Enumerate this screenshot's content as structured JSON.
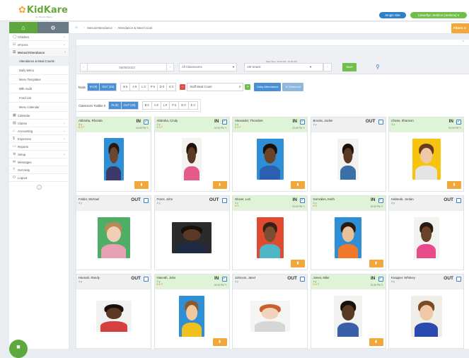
{
  "app": {
    "logo": "KidKare",
    "logo_tag": "by Minute Menu"
  },
  "header": {
    "site_button": "Single Site",
    "user_button": "Llewellyn Jenkins (Jenkins) ▾"
  },
  "sidebar": {
    "items": [
      {
        "label": "Children",
        "icon": "child-icon",
        "chevron": true
      },
      {
        "label": "eForms",
        "icon": "form-icon",
        "chevron": true
      },
      {
        "label": "Menus/Attendance",
        "icon": "menu-icon",
        "chevron": true,
        "active": true
      },
      {
        "label": "Calendar",
        "icon": "calendar-icon"
      },
      {
        "label": "Claims",
        "icon": "claims-icon",
        "chevron": true
      },
      {
        "label": "Accounting",
        "icon": "accounting-icon",
        "chevron": true
      },
      {
        "label": "Expenses",
        "icon": "dollar-icon",
        "chevron": true
      },
      {
        "label": "Reports",
        "icon": "reports-icon"
      },
      {
        "label": "Setup",
        "icon": "setup-icon",
        "chevron": true
      },
      {
        "label": "Messages",
        "icon": "messages-icon"
      },
      {
        "label": "Get Help",
        "icon": "help-icon"
      },
      {
        "label": "Logout",
        "icon": "logout-icon"
      }
    ],
    "subitems": [
      "Attendance & Meal Counts",
      "Daily Menu",
      "Menu Templates",
      "Milk Audit",
      "Food List",
      "Menu Calendar"
    ]
  },
  "breadcrumb": {
    "items": [
      "Menus/Attendance",
      "Attendance & Meal Count"
    ]
  },
  "filters_button": "Filters ∨",
  "filterbar": {
    "date": "06/08/2023",
    "classroom": "All Classrooms",
    "meal_time": "Meal Time: 10:15 AM - 10:30 AM",
    "meal": "AM Snack",
    "save": "Save"
  },
  "totals": {
    "label": "Totals",
    "in": "IN (8)",
    "out": "OUT (15)",
    "codes": [
      "B 5",
      "A 8",
      "L 0",
      "P 6",
      "D 0",
      "E 0"
    ],
    "staff_meal": "Staff Meal Count",
    "staff_meal_value": "0",
    "daily_attendance": "Daily Attendance",
    "select_all": "Select All"
  },
  "classroom": {
    "label": "Classroom Toddler II",
    "in": "IN (8)",
    "out": "OUT (23)",
    "codes": [
      "B 5",
      "A 8",
      "L 0",
      "P 6",
      "D 0",
      "E 0"
    ]
  },
  "children": [
    {
      "name": "Abbraha, Rhonda",
      "age": "4 y",
      "allergy": "B A P",
      "status": "IN",
      "time": "03:35 PM"
    },
    {
      "name": "Abbraha, Cindy",
      "age": "4 y",
      "allergy": "B A P",
      "status": "IN",
      "time": "03:35 PM"
    },
    {
      "name": "Alexander, Theodore",
      "age": "4 y",
      "allergy": "B A P",
      "status": "IN",
      "time": "03:35 PM"
    },
    {
      "name": "Brooks, Jackie",
      "age": "4 y",
      "allergy": "",
      "status": "OUT",
      "time": ""
    },
    {
      "name": "Chess, Shannon",
      "age": "4 y",
      "allergy": "",
      "status": "IN",
      "time": "03:35 PM"
    },
    {
      "name": "Felder, Michael",
      "age": "4 y",
      "allergy": "",
      "status": "OUT",
      "time": ""
    },
    {
      "name": "Frans, John",
      "age": "4 y",
      "allergy": "",
      "status": "OUT",
      "time": ""
    },
    {
      "name": "Glover, Lori",
      "age": "4 y",
      "allergy": "B A",
      "status": "IN",
      "time": "03:35 PM"
    },
    {
      "name": "Gonzales, Keith",
      "age": "4 y",
      "allergy": "B A",
      "status": "IN",
      "time": "03:35 PM"
    },
    {
      "name": "Habteab, Jordan",
      "age": "4 y",
      "allergy": "",
      "status": "OUT",
      "time": ""
    },
    {
      "name": "Hannah, Randy",
      "age": "4 y",
      "allergy": "",
      "status": "OUT",
      "time": ""
    },
    {
      "name": "Hannah, John",
      "age": "4 y",
      "allergy": "B A P",
      "status": "IN",
      "time": "03:35 PM"
    },
    {
      "name": "Johnson, Janet",
      "age": "4 y",
      "allergy": "",
      "status": "OUT",
      "time": ""
    },
    {
      "name": "Jones, Mike",
      "age": "4 y",
      "allergy": "B A P",
      "status": "IN",
      "time": "03:35 PM"
    },
    {
      "name": "Knapper, Whitney",
      "age": "4 y",
      "allergy": "",
      "status": "OUT",
      "time": ""
    }
  ],
  "colors": {
    "brand_green": "#6fbf4a",
    "accent_blue": "#2e7fc7",
    "orange": "#f2a73a",
    "in_bg": "#dff3d6"
  }
}
